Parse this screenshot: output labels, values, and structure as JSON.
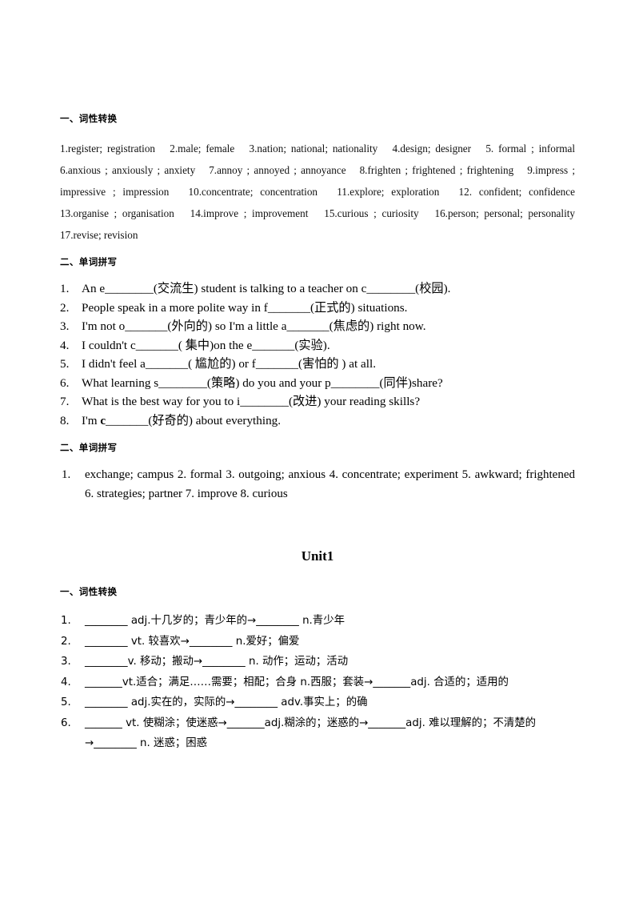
{
  "sections": {
    "heading_word_forms": "一、词性转换",
    "heading_spelling": "二、单词拼写",
    "heading_spelling_answers": "二、单词拼写",
    "unit_title": "Unit1",
    "heading_word_forms_2": "一、词性转换"
  },
  "word_form_answers": {
    "text": "1.register; registration　2.male; female　3.nation; national; nationality　4.design; designer　5. formal ; informal　6.anxious ; anxiously ; anxiety　7.annoy ; annoyed ; annoyance　8.frighten ; frightened ; frightening　9.impress ; impressive ; impression　10.concentrate; concentration　11.explore; exploration　12. confident; confidence　13.organise ; organisation　14.improve ; improvement　15.curious ; curiosity　16.person; personal; personality　17.revise; revision"
  },
  "spelling_questions": [
    {
      "num": "1.",
      "parts": [
        {
          "t": "An e",
          "k": "text"
        },
        {
          "t": "________",
          "k": "blank"
        },
        {
          "t": "(交流生) student is talking to a teacher on c",
          "k": "text"
        },
        {
          "t": "________",
          "k": "blank"
        },
        {
          "t": "(校园).",
          "k": "text"
        }
      ]
    },
    {
      "num": "2.",
      "parts": [
        {
          "t": "People speak in a more polite way in f",
          "k": "text"
        },
        {
          "t": "_______",
          "k": "blank"
        },
        {
          "t": "(正式的) situations.",
          "k": "text"
        }
      ]
    },
    {
      "num": "3.",
      "parts": [
        {
          "t": " I'm not o",
          "k": "text"
        },
        {
          "t": "_______",
          "k": "blank"
        },
        {
          "t": "(外向的) so I'm a little a",
          "k": "text"
        },
        {
          "t": "_______",
          "k": "blank"
        },
        {
          "t": "(焦虑的) right now.",
          "k": "text"
        }
      ]
    },
    {
      "num": "4.",
      "parts": [
        {
          "t": "I couldn't c",
          "k": "text"
        },
        {
          "t": "_______",
          "k": "blank"
        },
        {
          "t": "( 集中)on the e",
          "k": "text"
        },
        {
          "t": "_______",
          "k": "blank"
        },
        {
          "t": "(实验).",
          "k": "text"
        }
      ]
    },
    {
      "num": "5.",
      "parts": [
        {
          "t": "I didn't feel a",
          "k": "text"
        },
        {
          "t": "_______",
          "k": "blank"
        },
        {
          "t": "( 尴尬的) or f",
          "k": "text"
        },
        {
          "t": "_______",
          "k": "blank"
        },
        {
          "t": "(害怕的 ) at all.",
          "k": "text"
        }
      ]
    },
    {
      "num": "6.",
      "parts": [
        {
          "t": "What learning s",
          "k": "text"
        },
        {
          "t": "________",
          "k": "blank"
        },
        {
          "t": "(策略) do you and your p",
          "k": "text"
        },
        {
          "t": "________",
          "k": "blank"
        },
        {
          "t": "(同伴)share?",
          "k": "text"
        }
      ]
    },
    {
      "num": "7.",
      "parts": [
        {
          "t": "What is the best way for you to i",
          "k": "text"
        },
        {
          "t": "________",
          "k": "blank"
        },
        {
          "t": "(改进) your reading skills?",
          "k": "text"
        }
      ]
    },
    {
      "num": "8.",
      "parts": [
        {
          "t": "I'm ",
          "k": "text"
        },
        {
          "t": "c",
          "k": "bold"
        },
        {
          "t": "_______",
          "k": "blank"
        },
        {
          "t": "(好奇的) about everything.",
          "k": "text"
        }
      ]
    }
  ],
  "spelling_answers": {
    "num": "1.",
    "text": "exchange; campus 2. formal 3. outgoing; anxious 4. concentrate; experiment 5. awkward; frightened 6. strategies; partner 7. improve 8. curious"
  },
  "unit1_word_forms": [
    {
      "num": "1.",
      "parts": [
        {
          "t": " ________",
          "k": "blank"
        },
        {
          "t": " adj.十几岁的；青少年的→",
          "k": "text"
        },
        {
          "t": "________",
          "k": "blank"
        },
        {
          "t": " n.青少年",
          "k": "text"
        }
      ]
    },
    {
      "num": "2.",
      "parts": [
        {
          "t": " ________",
          "k": "blank"
        },
        {
          "t": " vt. 较喜欢→",
          "k": "text"
        },
        {
          "t": "________",
          "k": "blank"
        },
        {
          "t": " n.爱好；偏爱",
          "k": "text"
        }
      ]
    },
    {
      "num": "3.",
      "parts": [
        {
          "t": " ________",
          "k": "blank"
        },
        {
          "t": "v. 移动；搬动→",
          "k": "text"
        },
        {
          "t": "________",
          "k": "blank"
        },
        {
          "t": " n. 动作；运动；活动",
          "k": "text"
        }
      ]
    },
    {
      "num": "4.",
      "parts": [
        {
          "t": " _______",
          "k": "blank"
        },
        {
          "t": "vt.适合；满足……需要；相配；合身 n.西服；套装→",
          "k": "text"
        },
        {
          "t": "_______",
          "k": "blank"
        },
        {
          "t": "adj. 合适的；适用的",
          "k": "text"
        }
      ]
    },
    {
      "num": "5.",
      "parts": [
        {
          "t": " ________",
          "k": "blank"
        },
        {
          "t": " adj.实在的，实际的→",
          "k": "text"
        },
        {
          "t": "________",
          "k": "blank"
        },
        {
          "t": " adv.事实上；的确",
          "k": "text"
        }
      ]
    },
    {
      "num": "6.",
      "parts": [
        {
          "t": " _______",
          "k": "blank"
        },
        {
          "t": " vt. 使糊涂；使迷惑→",
          "k": "text"
        },
        {
          "t": "_______",
          "k": "blank"
        },
        {
          "t": "adj.糊涂的；迷惑的→",
          "k": "text"
        },
        {
          "t": "_______",
          "k": "blank"
        },
        {
          "t": "adj. 难以理解的；不清楚的→",
          "k": "text"
        },
        {
          "t": "________",
          "k": "blank"
        },
        {
          "t": " n. 迷惑；困惑",
          "k": "text"
        }
      ]
    }
  ],
  "colors": {
    "text": "#000000",
    "page_bg": "#ffffff"
  }
}
